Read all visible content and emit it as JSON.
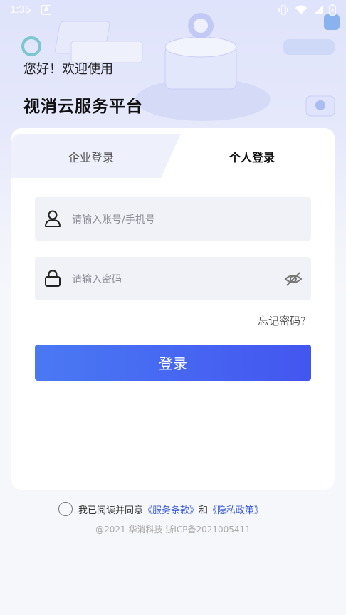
{
  "status_bar": {
    "time": "1:35"
  },
  "header": {
    "greeting": "您好！欢迎使用",
    "platform_name": "视消云服务平台"
  },
  "tabs": [
    {
      "label": "企业登录",
      "active": false
    },
    {
      "label": "个人登录",
      "active": true
    }
  ],
  "form": {
    "account_placeholder": "请输入账号/手机号",
    "password_placeholder": "请输入密码",
    "forgot_label": "忘记密码?",
    "login_label": "登录"
  },
  "agreement": {
    "prefix": "我已阅读并同意",
    "terms_label": "《服务条款》",
    "conjunction": "和",
    "privacy_label": "《隐私政策》",
    "checked": false
  },
  "footer": {
    "icp": "@2021 华消科技 浙ICP备2021005411"
  },
  "colors": {
    "accent": "#4356f0",
    "link": "#3a5bd9"
  }
}
